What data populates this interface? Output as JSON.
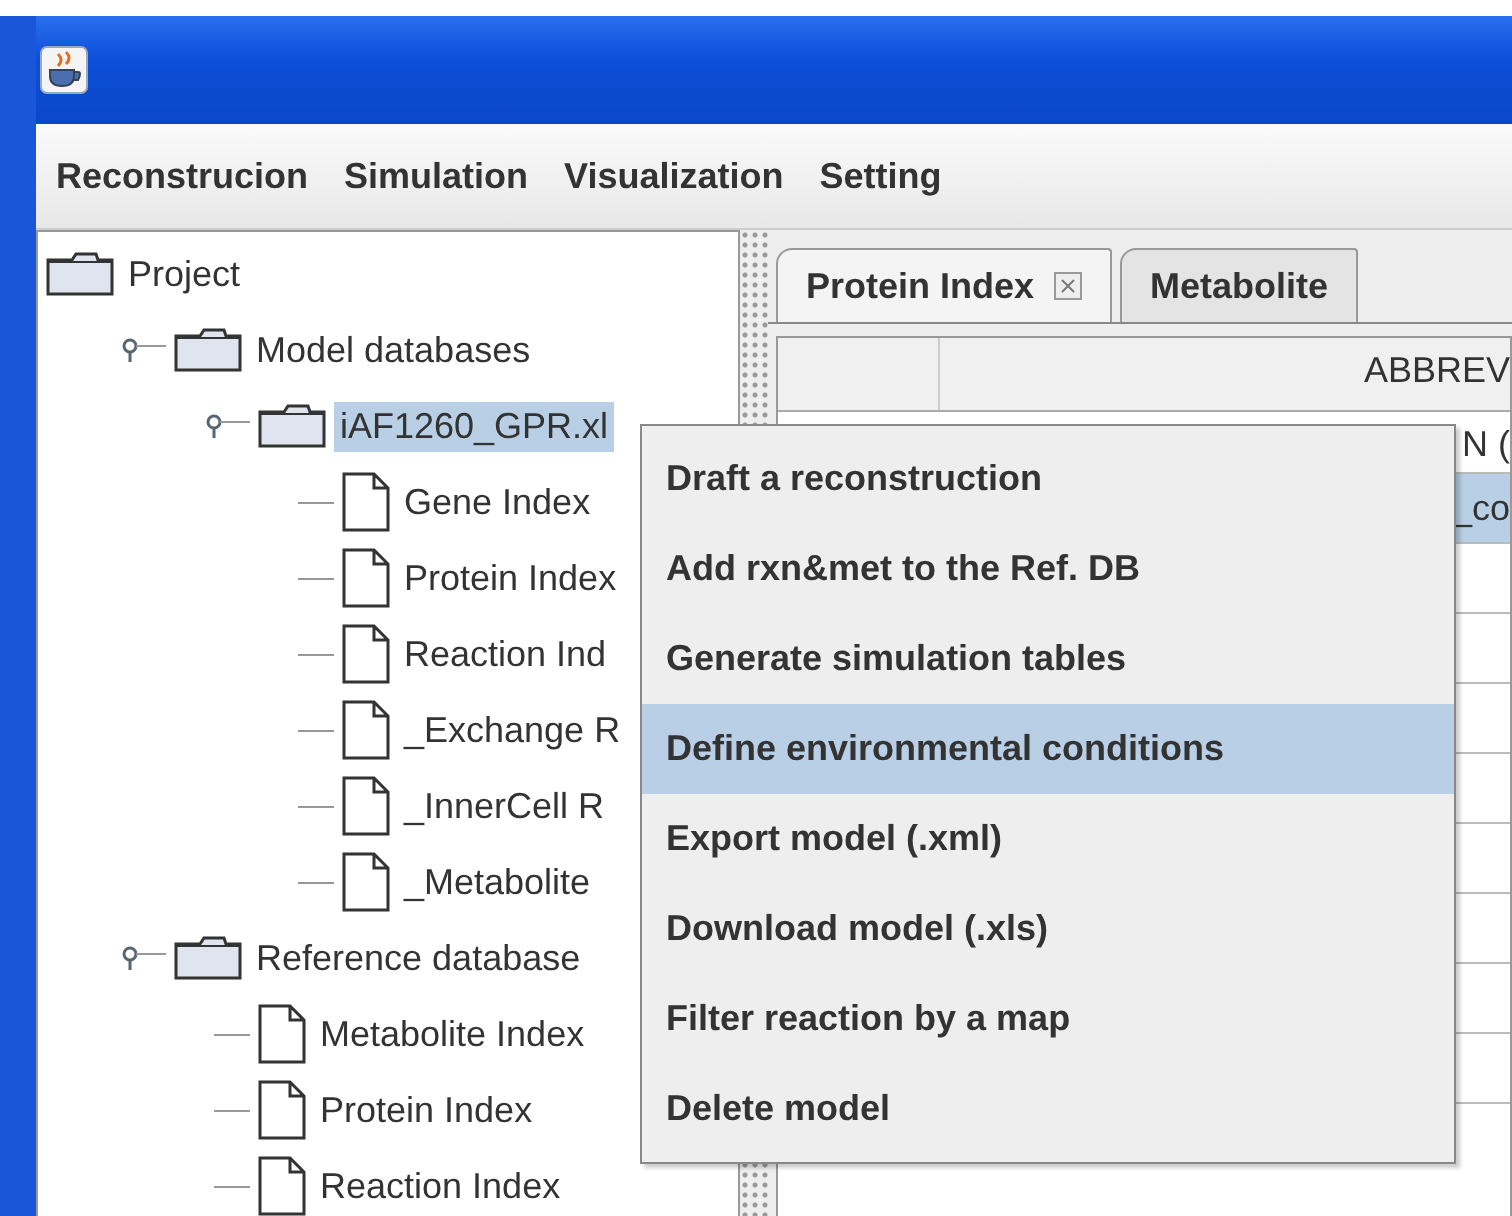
{
  "menu_bar": [
    "Reconstrucion",
    "Simulation",
    "Visualization",
    "Setting"
  ],
  "tree": [
    {
      "label": "Project",
      "kind": "folder",
      "selected": false,
      "children": [
        {
          "label": "Model databases",
          "kind": "folder",
          "expanded": true,
          "selected": false,
          "children": [
            {
              "label": "iAF1260_GPR.xl",
              "kind": "folder",
              "expanded": true,
              "selected": true,
              "children": [
                {
                  "label": "Gene Index",
                  "kind": "file",
                  "selected": false
                },
                {
                  "label": "Protein Index",
                  "kind": "file",
                  "selected": false
                },
                {
                  "label": "Reaction Ind",
                  "kind": "file",
                  "selected": false
                },
                {
                  "label": "_Exchange R",
                  "kind": "file",
                  "selected": false
                },
                {
                  "label": "_InnerCell R",
                  "kind": "file",
                  "selected": false
                },
                {
                  "label": "_Metabolite",
                  "kind": "file",
                  "selected": false
                }
              ]
            }
          ]
        },
        {
          "label": "Reference database",
          "kind": "folder",
          "expanded": true,
          "selected": false,
          "children": [
            {
              "label": "Metabolite Index",
              "kind": "file",
              "selected": false
            },
            {
              "label": "Protein Index",
              "kind": "file",
              "selected": false
            },
            {
              "label": "Reaction Index",
              "kind": "file",
              "selected": false
            }
          ]
        }
      ]
    }
  ],
  "tabs": [
    {
      "label": "Protein Index",
      "closable": true,
      "selected": true
    },
    {
      "label": "Metabolite",
      "closable": false,
      "selected": false
    }
  ],
  "table": {
    "header": "ABBREV",
    "header_2": "N (",
    "rows": [
      {
        "cells": [
          "",
          "_co"
        ],
        "selected": true
      }
    ]
  },
  "context_menu": [
    {
      "label": "Draft a reconstruction",
      "selected": false
    },
    {
      "label": "Add rxn&met to the Ref. DB",
      "selected": false
    },
    {
      "label": "Generate simulation tables",
      "selected": false
    },
    {
      "label": "Define environmental conditions",
      "selected": true
    },
    {
      "label": "Export model (.xml)",
      "selected": false
    },
    {
      "label": "Download model (.xls)",
      "selected": false
    },
    {
      "label": "Filter reaction by a map",
      "selected": false
    },
    {
      "label": "Delete model",
      "selected": false
    }
  ]
}
